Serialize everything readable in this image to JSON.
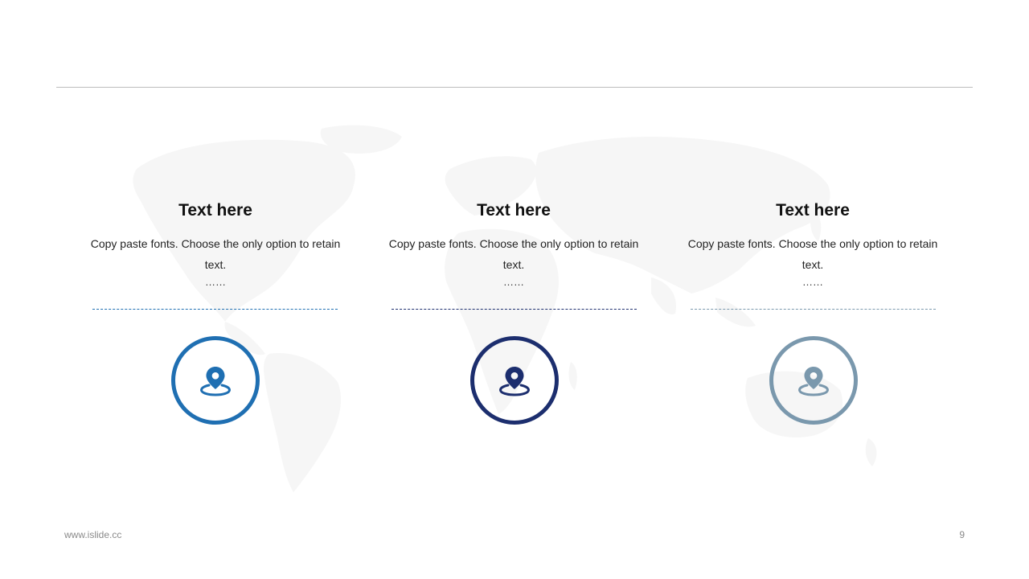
{
  "columns": [
    {
      "title": "Text here",
      "body": "Copy paste fonts. Choose the only option to retain text.",
      "ellipsis": "……",
      "color": "#1f6fb2",
      "icon": "location-pin-icon"
    },
    {
      "title": "Text here",
      "body": "Copy paste fonts. Choose the only option to retain text.",
      "ellipsis": "……",
      "color": "#1c2e6e",
      "icon": "location-pin-icon"
    },
    {
      "title": "Text here",
      "body": "Copy paste fonts. Choose the only option to retain text.",
      "ellipsis": "……",
      "color": "#7a98ad",
      "icon": "location-pin-icon"
    }
  ],
  "footer": {
    "url": "www.islide.cc",
    "page_number": "9"
  },
  "colors": {
    "divider": "#bdbdbd",
    "map": "#f6f6f6"
  }
}
